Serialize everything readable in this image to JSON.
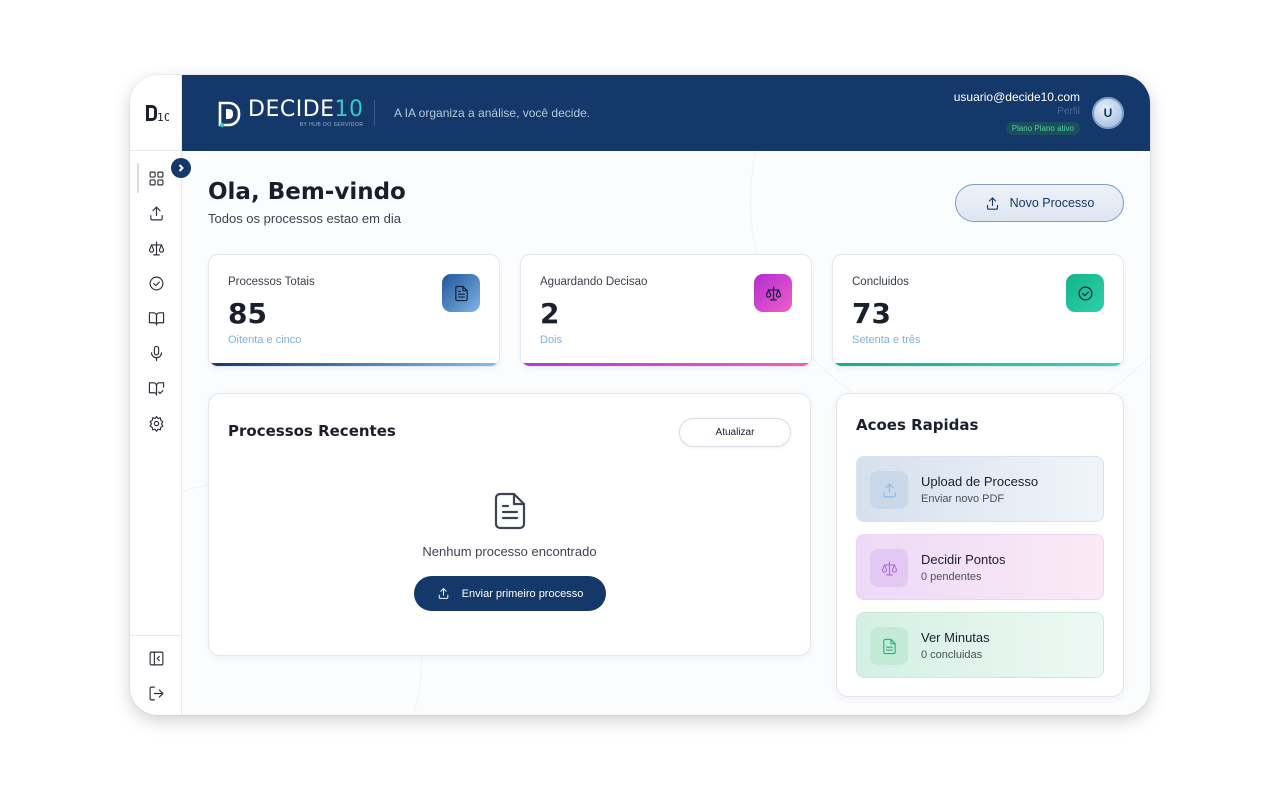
{
  "brand": {
    "rail_logo": "D10",
    "name_prefix": "DECIDE",
    "name_suffix": "10",
    "sub": "BY HUB DO SERVIDOR",
    "tagline": "A IA organiza a análise, você decide."
  },
  "user": {
    "email": "usuario@decide10.com",
    "role": "Perfil",
    "plan": "Plano Plano ativo",
    "avatar_initial": "U"
  },
  "sidebar": {
    "icons": [
      "dashboard-icon",
      "upload-icon",
      "scale-icon",
      "check-circle-icon",
      "book-icon",
      "microphone-icon",
      "book-check-icon",
      "gear-icon"
    ],
    "bottom_icons": [
      "collapse-sidebar-icon",
      "logout-icon"
    ]
  },
  "page": {
    "greeting": "Ola, Bem-vindo",
    "subtitle": "Todos os processos estao em dia",
    "new_process_label": "Novo Processo"
  },
  "stats": [
    {
      "label": "Processos Totais",
      "value": "85",
      "words": "Oitenta e cinco",
      "icon": "document-icon",
      "color": "#2d6ab0"
    },
    {
      "label": "Aguardando Decisao",
      "value": "2",
      "words": "Dois",
      "icon": "scale-icon",
      "color": "#c43fd0"
    },
    {
      "label": "Concluidos",
      "value": "73",
      "words": "Setenta e três",
      "icon": "check-circle-icon",
      "color": "#18b891"
    }
  ],
  "recent": {
    "title": "Processos Recentes",
    "refresh_label": "Atualizar",
    "empty_text": "Nenhum processo encontrado",
    "send_label": "Enviar primeiro processo"
  },
  "quick": {
    "title": "Acoes Rapidas",
    "items": [
      {
        "title": "Upload de Processo",
        "sub": "Enviar novo PDF",
        "icon": "upload-icon"
      },
      {
        "title": "Decidir Pontos",
        "sub": "0 pendentes",
        "icon": "scale-icon"
      },
      {
        "title": "Ver Minutas",
        "sub": "0 concluidas",
        "icon": "document-icon"
      }
    ]
  }
}
